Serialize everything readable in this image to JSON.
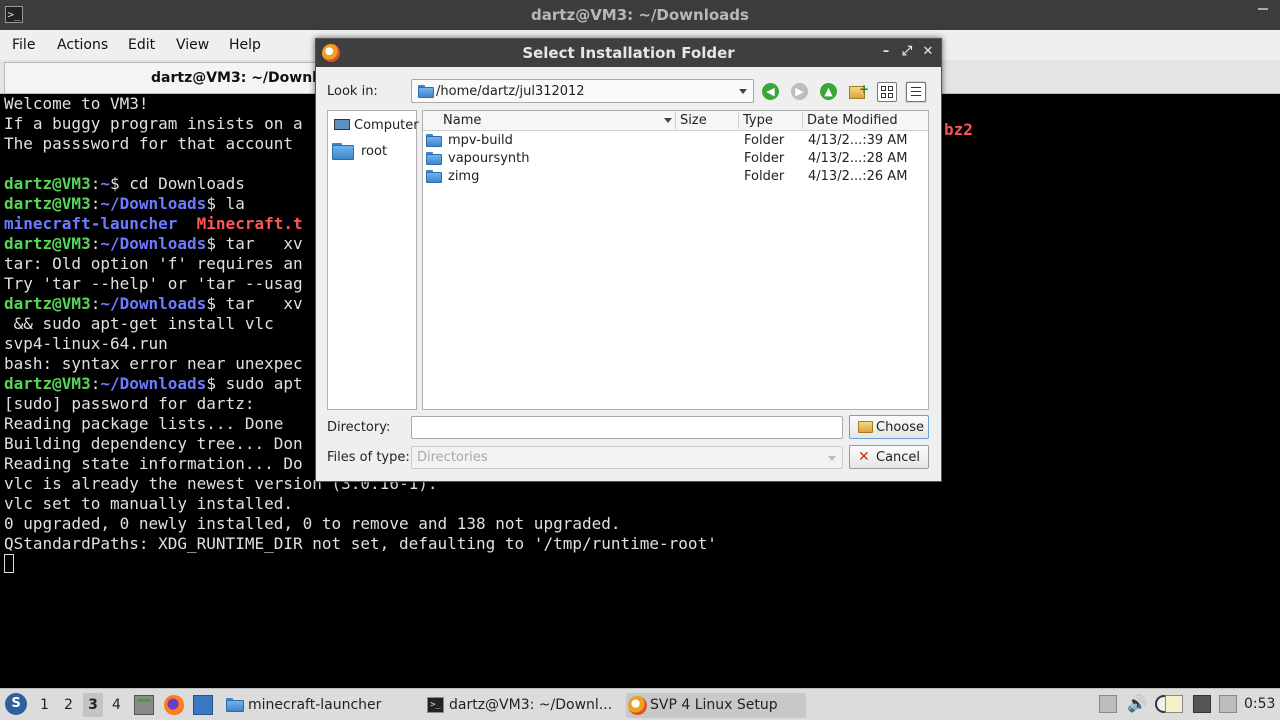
{
  "terminal": {
    "window_title": "dartz@VM3: ~/Downloads",
    "tab_title": "dartz@VM3: ~/Downloa",
    "menu": [
      "File",
      "Actions",
      "Edit",
      "View",
      "Help"
    ],
    "lines": [
      {
        "segs": [
          {
            "t": "Welcome to VM3!"
          }
        ]
      },
      {
        "segs": [
          {
            "t": "If a buggy program insists on a"
          }
        ]
      },
      {
        "segs": [
          {
            "t": "The passsword for that account"
          }
        ]
      },
      {
        "segs": [
          {
            "t": ""
          }
        ]
      },
      {
        "segs": [
          {
            "t": "dartz@VM3",
            "c": "u"
          },
          {
            "t": ":"
          },
          {
            "t": "~",
            "c": "p"
          },
          {
            "t": "$ cd Downloads"
          }
        ]
      },
      {
        "segs": [
          {
            "t": "dartz@VM3",
            "c": "u"
          },
          {
            "t": ":"
          },
          {
            "t": "~/Downloads",
            "c": "p"
          },
          {
            "t": "$ la"
          }
        ]
      },
      {
        "segs": [
          {
            "t": "minecraft-launcher",
            "c": "dir"
          },
          {
            "t": "  "
          },
          {
            "t": "Minecraft.t",
            "c": "arc"
          }
        ]
      },
      {
        "segs": [
          {
            "t": "dartz@VM3",
            "c": "u"
          },
          {
            "t": ":"
          },
          {
            "t": "~/Downloads",
            "c": "p"
          },
          {
            "t": "$ tar   xv"
          }
        ]
      },
      {
        "segs": [
          {
            "t": "tar: Old option 'f' requires an"
          }
        ]
      },
      {
        "segs": [
          {
            "t": "Try 'tar --help' or 'tar --usag"
          }
        ]
      },
      {
        "segs": [
          {
            "t": "dartz@VM3",
            "c": "u"
          },
          {
            "t": ":"
          },
          {
            "t": "~/Downloads",
            "c": "p"
          },
          {
            "t": "$ tar   xv"
          }
        ]
      },
      {
        "segs": [
          {
            "t": " && sudo apt-get install vlc"
          }
        ]
      },
      {
        "segs": [
          {
            "t": "svp4-linux-64.run"
          }
        ]
      },
      {
        "segs": [
          {
            "t": "bash: syntax error near unexpec"
          }
        ]
      },
      {
        "segs": [
          {
            "t": "dartz@VM3",
            "c": "u"
          },
          {
            "t": ":"
          },
          {
            "t": "~/Downloads",
            "c": "p"
          },
          {
            "t": "$ sudo apt"
          }
        ]
      },
      {
        "segs": [
          {
            "t": "[sudo] password for dartz:"
          }
        ]
      },
      {
        "segs": [
          {
            "t": "Reading package lists... Done"
          }
        ]
      },
      {
        "segs": [
          {
            "t": "Building dependency tree... Don"
          }
        ]
      },
      {
        "segs": [
          {
            "t": "Reading state information... Do"
          }
        ]
      },
      {
        "segs": [
          {
            "t": "vlc is already the newest version (3.0.16-1)."
          }
        ]
      },
      {
        "segs": [
          {
            "t": "vlc set to manually installed."
          }
        ]
      },
      {
        "segs": [
          {
            "t": "0 upgraded, 0 newly installed, 0 to remove and 138 not upgraded."
          }
        ]
      },
      {
        "segs": [
          {
            "t": "QStandardPaths: XDG_RUNTIME_DIR not set, defaulting to '/tmp/runtime-root'"
          }
        ]
      }
    ],
    "right_fragment": "bz2"
  },
  "dialog": {
    "title": "Select Installation Folder",
    "look_in_label": "Look in:",
    "look_in_value": "/home/dartz/jul312012",
    "sidebar": [
      "Computer",
      "root"
    ],
    "columns": [
      "Name",
      "Size",
      "Type",
      "Date Modified"
    ],
    "files": [
      {
        "name": "mpv-build",
        "size": "",
        "type": "Folder",
        "date": "4/13/2...:39 AM"
      },
      {
        "name": "vapoursynth",
        "size": "",
        "type": "Folder",
        "date": "4/13/2...:28 AM"
      },
      {
        "name": "zimg",
        "size": "",
        "type": "Folder",
        "date": "4/13/2...:26 AM"
      }
    ],
    "directory_label": "Directory:",
    "directory_value": "",
    "files_of_type_label": "Files of type:",
    "files_of_type_value": "Directories",
    "choose_label": "Choose",
    "cancel_label": "Cancel"
  },
  "taskbar": {
    "workspaces": [
      "1",
      "2",
      "3",
      "4"
    ],
    "active_workspace": "3",
    "tasks": [
      "minecraft-launcher",
      "dartz@VM3: ~/Downl...",
      "SVP 4 Linux Setup"
    ],
    "clock": "0:53"
  }
}
